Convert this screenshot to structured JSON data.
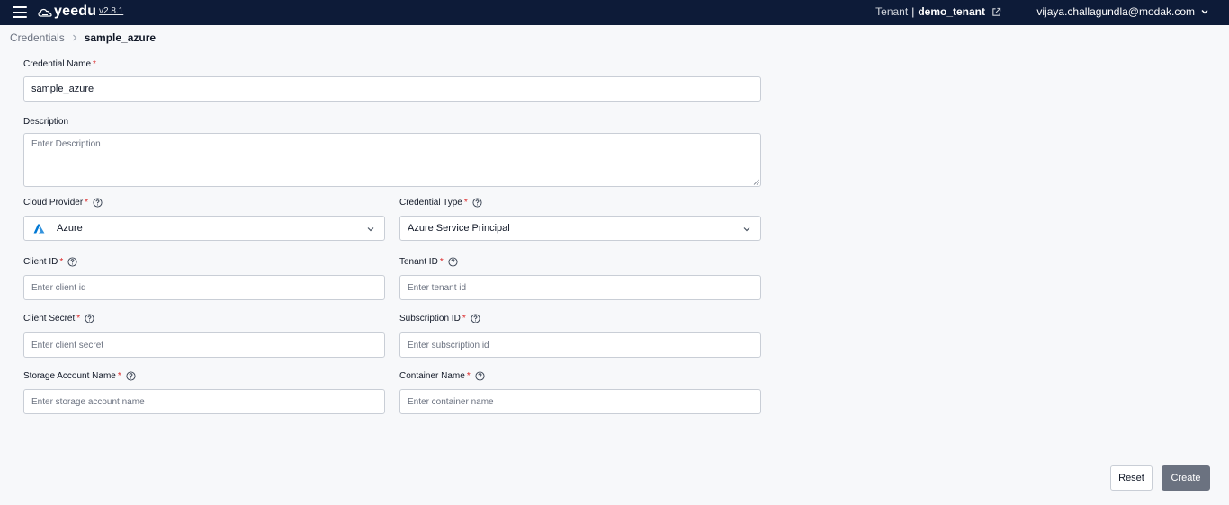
{
  "header": {
    "app_name": "yeedu",
    "version": "v2.8.1",
    "tenant_label": "Tenant",
    "tenant_sep": "|",
    "tenant_name": "demo_tenant",
    "user_email": "vijaya.challagundla@modak.com",
    "menu_icon": "hamburger-menu-icon",
    "external_link_icon": "external-link-icon",
    "user_menu_icon": "chevron-down-icon"
  },
  "breadcrumb": {
    "parent": "Credentials",
    "current": "sample_azure"
  },
  "form": {
    "credential_name": {
      "label": "Credential Name",
      "required_mark": "*",
      "value": "sample_azure"
    },
    "description": {
      "label": "Description",
      "placeholder": "Enter Description"
    },
    "cloud_provider": {
      "label": "Cloud Provider",
      "required_mark": "*",
      "value": "Azure",
      "icon": "azure-logo-icon"
    },
    "credential_type": {
      "label": "Credential Type",
      "required_mark": "*",
      "value": "Azure Service Principal"
    },
    "client_id": {
      "label": "Client ID",
      "required_mark": "*",
      "placeholder": "Enter client id"
    },
    "tenant_id": {
      "label": "Tenant ID",
      "required_mark": "*",
      "placeholder": "Enter tenant id"
    },
    "client_secret": {
      "label": "Client Secret",
      "required_mark": "*",
      "placeholder": "Enter client secret"
    },
    "subscription_id": {
      "label": "Subscription ID",
      "required_mark": "*",
      "placeholder": "Enter subscription id"
    },
    "storage_account_name": {
      "label": "Storage Account Name",
      "required_mark": "*",
      "placeholder": "Enter storage account name"
    },
    "container_name": {
      "label": "Container Name",
      "required_mark": "*",
      "placeholder": "Enter container name"
    }
  },
  "actions": {
    "reset_label": "Reset",
    "create_label": "Create"
  },
  "colors": {
    "header_bg": "#0d1b38",
    "page_bg": "#f7f8fa",
    "required": "#dc2626",
    "create_button_bg": "#6b7280",
    "azure_brand": "#0078d4"
  }
}
